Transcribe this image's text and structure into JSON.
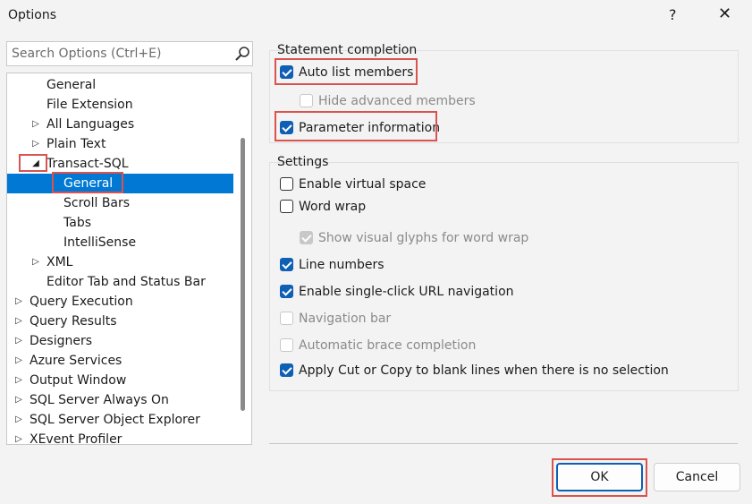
{
  "window": {
    "title": "Options",
    "help": "?",
    "close": "✕"
  },
  "search": {
    "placeholder": "Search Options (Ctrl+E)"
  },
  "tree": {
    "items": [
      {
        "label": "General",
        "arrow": ""
      },
      {
        "label": "File Extension",
        "arrow": ""
      },
      {
        "label": "All Languages",
        "arrow": "▷"
      },
      {
        "label": "Plain Text",
        "arrow": "▷"
      },
      {
        "label": "Transact-SQL",
        "arrow": "◢"
      },
      {
        "label": "General",
        "arrow": "",
        "selected": true
      },
      {
        "label": "Scroll Bars",
        "arrow": ""
      },
      {
        "label": "Tabs",
        "arrow": ""
      },
      {
        "label": "IntelliSense",
        "arrow": ""
      },
      {
        "label": "XML",
        "arrow": "▷"
      },
      {
        "label": "Editor Tab and Status Bar",
        "arrow": ""
      },
      {
        "label": "Query Execution",
        "arrow": "▷"
      },
      {
        "label": "Query Results",
        "arrow": "▷"
      },
      {
        "label": "Designers",
        "arrow": "▷"
      },
      {
        "label": "Azure Services",
        "arrow": "▷"
      },
      {
        "label": "Output Window",
        "arrow": "▷"
      },
      {
        "label": "SQL Server Always On",
        "arrow": "▷"
      },
      {
        "label": "SQL Server Object Explorer",
        "arrow": "▷"
      },
      {
        "label": "XEvent Profiler",
        "arrow": "▷"
      }
    ]
  },
  "statement_completion": {
    "title": "Statement completion",
    "options": [
      {
        "label": "Auto list members",
        "state": "on"
      },
      {
        "label": "Hide advanced members",
        "state": "dis-off"
      },
      {
        "label": "Parameter information",
        "state": "on"
      }
    ]
  },
  "settings": {
    "title": "Settings",
    "options": [
      {
        "label": "Enable virtual space",
        "state": "off"
      },
      {
        "label": "Word wrap",
        "state": "off"
      },
      {
        "label": "Show visual glyphs for word wrap",
        "state": "dis-on"
      },
      {
        "label": "Line numbers",
        "state": "on"
      },
      {
        "label": "Enable single-click URL navigation",
        "state": "on"
      },
      {
        "label": "Navigation bar",
        "state": "dis-off"
      },
      {
        "label": "Automatic brace completion",
        "state": "dis-off"
      },
      {
        "label": "Apply Cut or Copy to blank lines when there is no selection",
        "state": "on"
      }
    ]
  },
  "buttons": {
    "ok": "OK",
    "cancel": "Cancel"
  },
  "colors": {
    "accent": "#0078d4",
    "checkbox": "#0f5fb5",
    "highlight": "#d9534f"
  }
}
